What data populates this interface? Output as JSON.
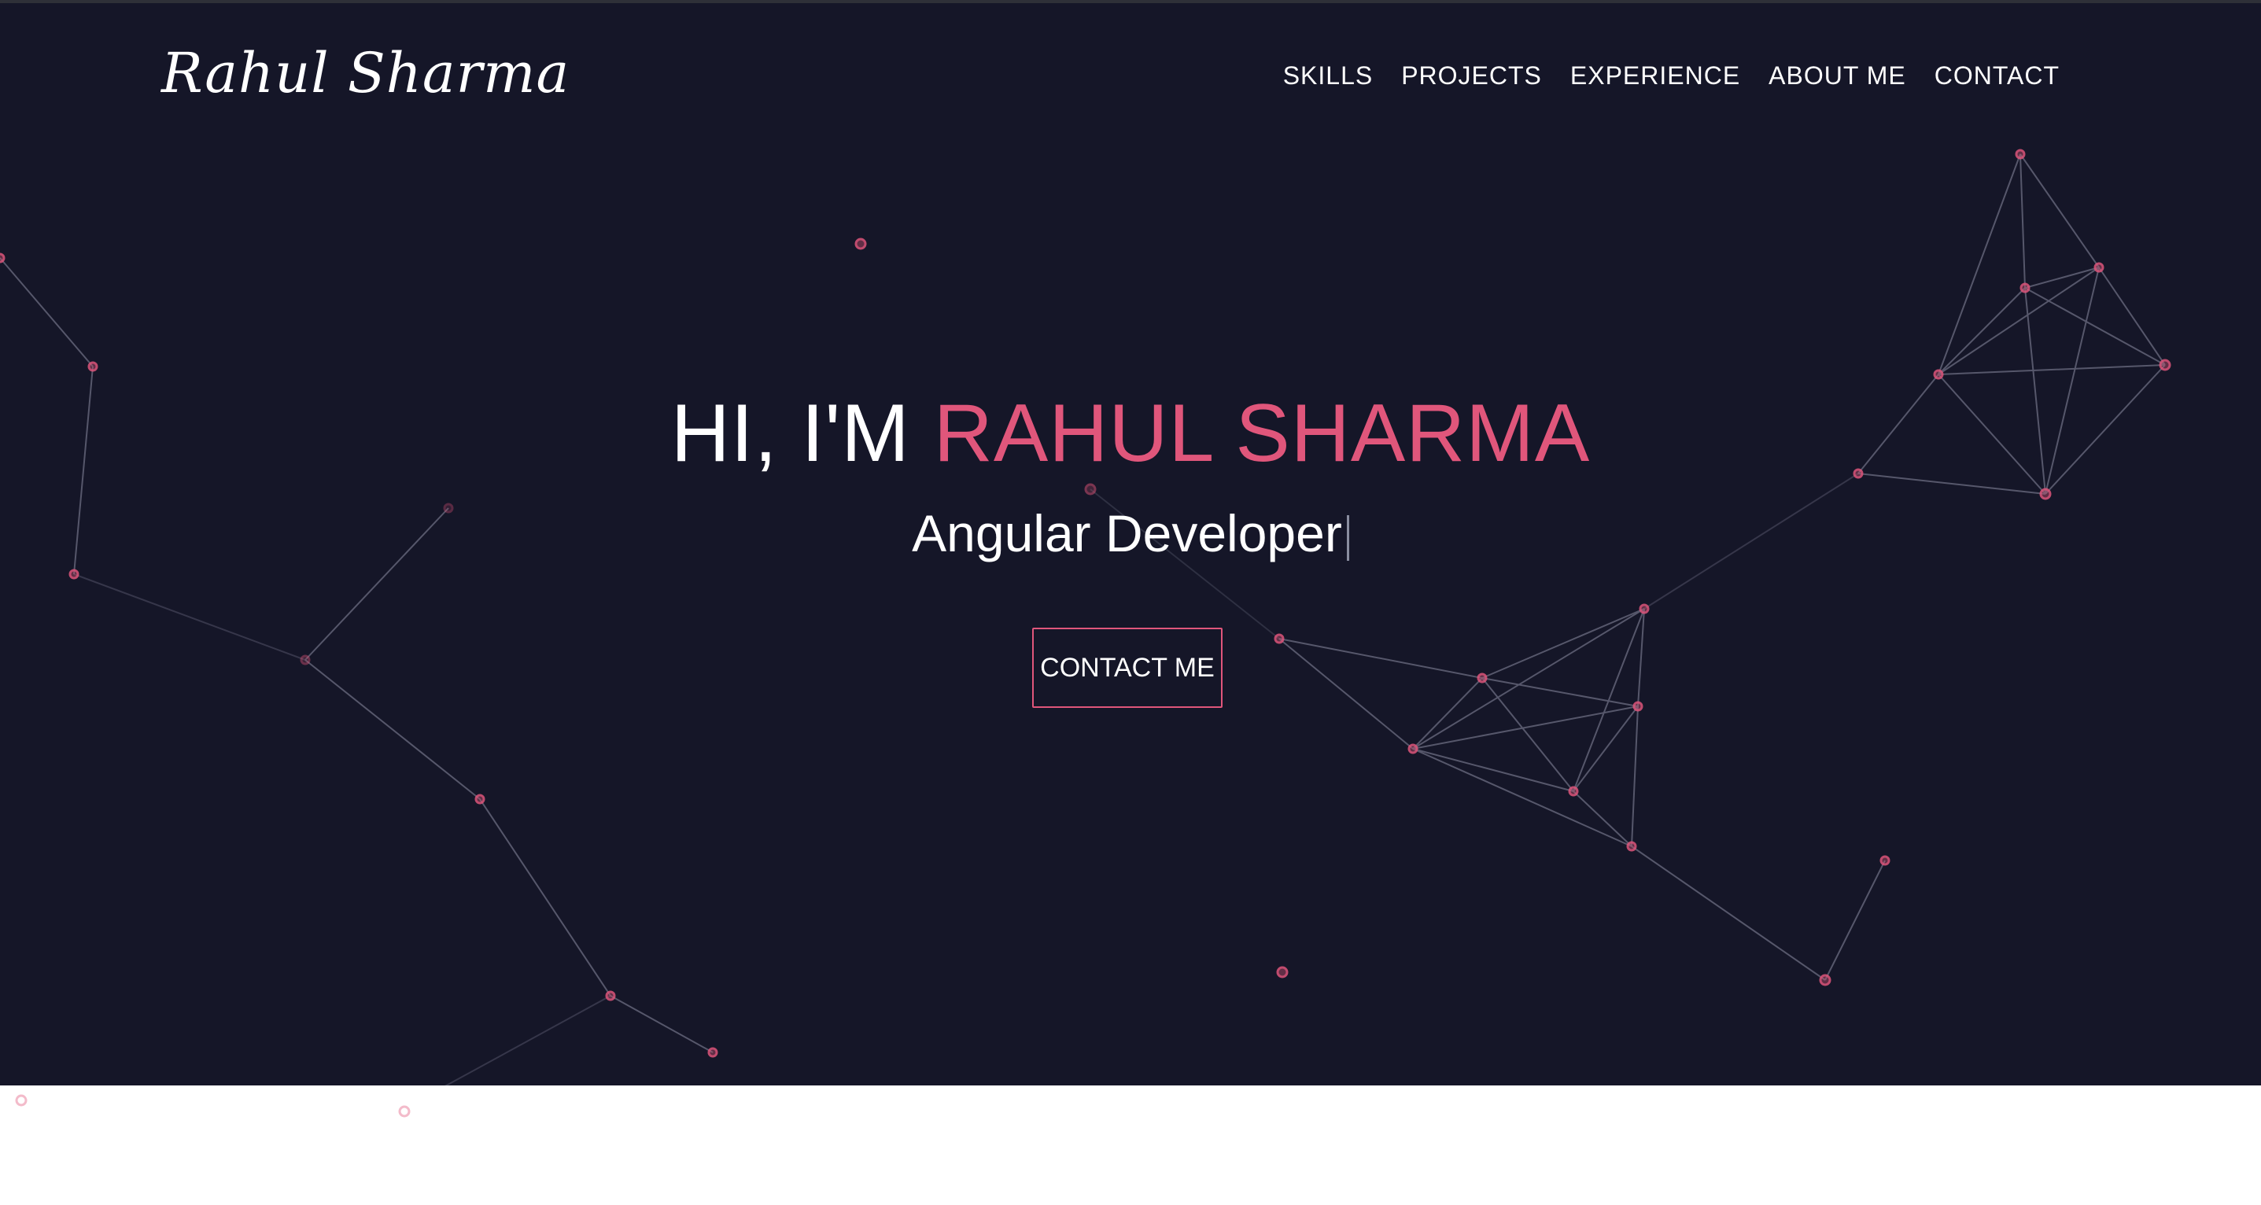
{
  "header": {
    "brand": "Rahul Sharma",
    "nav": [
      "SKILLS",
      "PROJECTS",
      "EXPERIENCE",
      "ABOUT ME",
      "CONTACT"
    ]
  },
  "hero": {
    "greeting": "HI, I'M",
    "name": "RAHUL SHARMA",
    "role": "Angular Developer",
    "cta": "CONTACT ME"
  },
  "colors": {
    "background": "#151628",
    "accent": "#e0567b",
    "text": "#ffffff",
    "below_fold": "#ffffff"
  }
}
